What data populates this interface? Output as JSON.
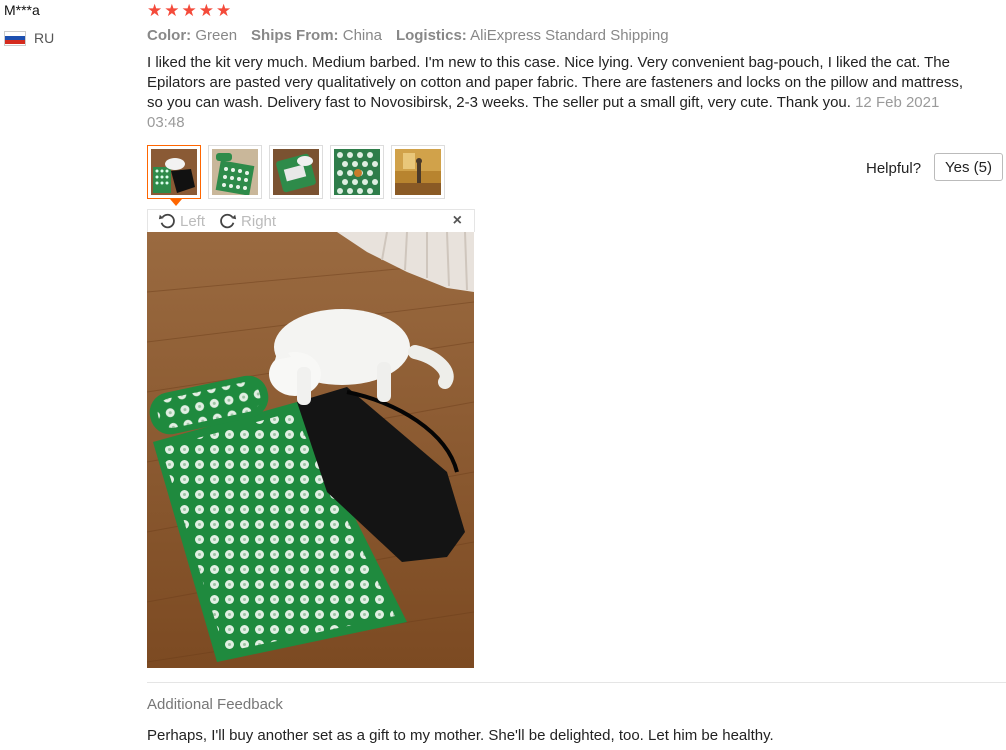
{
  "user": {
    "name": "M***a",
    "country": "RU"
  },
  "rating": {
    "stars": 5,
    "star_glyph": "★",
    "color": "#f44a3a"
  },
  "attributes": [
    {
      "label": "Color:",
      "value": "Green"
    },
    {
      "label": "Ships From:",
      "value": "China"
    },
    {
      "label": "Logistics:",
      "value": "AliExpress Standard Shipping"
    }
  ],
  "review": {
    "text": "I liked the kit very much. Medium barbed. I'm new to this case. Nice lying. Very convenient bag-pouch, I liked the cat. The Epilators are pasted very qualitatively on cotton and paper fabric. There are fasteners and locks on the pillow and mattress, so you can wash. Delivery fast to Novosibirsk, 2-3 weeks. The seller put a small gift, very cute. Thank you.",
    "date": "12 Feb 2021 03:48"
  },
  "thumbnails": [
    {
      "name": "cat-mat-photo"
    },
    {
      "name": "mat-pillow-photo"
    },
    {
      "name": "bag-photo"
    },
    {
      "name": "mat-closeup-photo"
    },
    {
      "name": "room-photo"
    }
  ],
  "helpful": {
    "label": "Helpful?",
    "button": "Yes (5)"
  },
  "viewer": {
    "left_label": "Left",
    "right_label": "Right",
    "close_label": "×"
  },
  "additional": {
    "title": "Additional Feedback",
    "text": "Perhaps, I'll buy another set as a gift to my mother. She'll be delighted, too. Let him be healthy."
  }
}
